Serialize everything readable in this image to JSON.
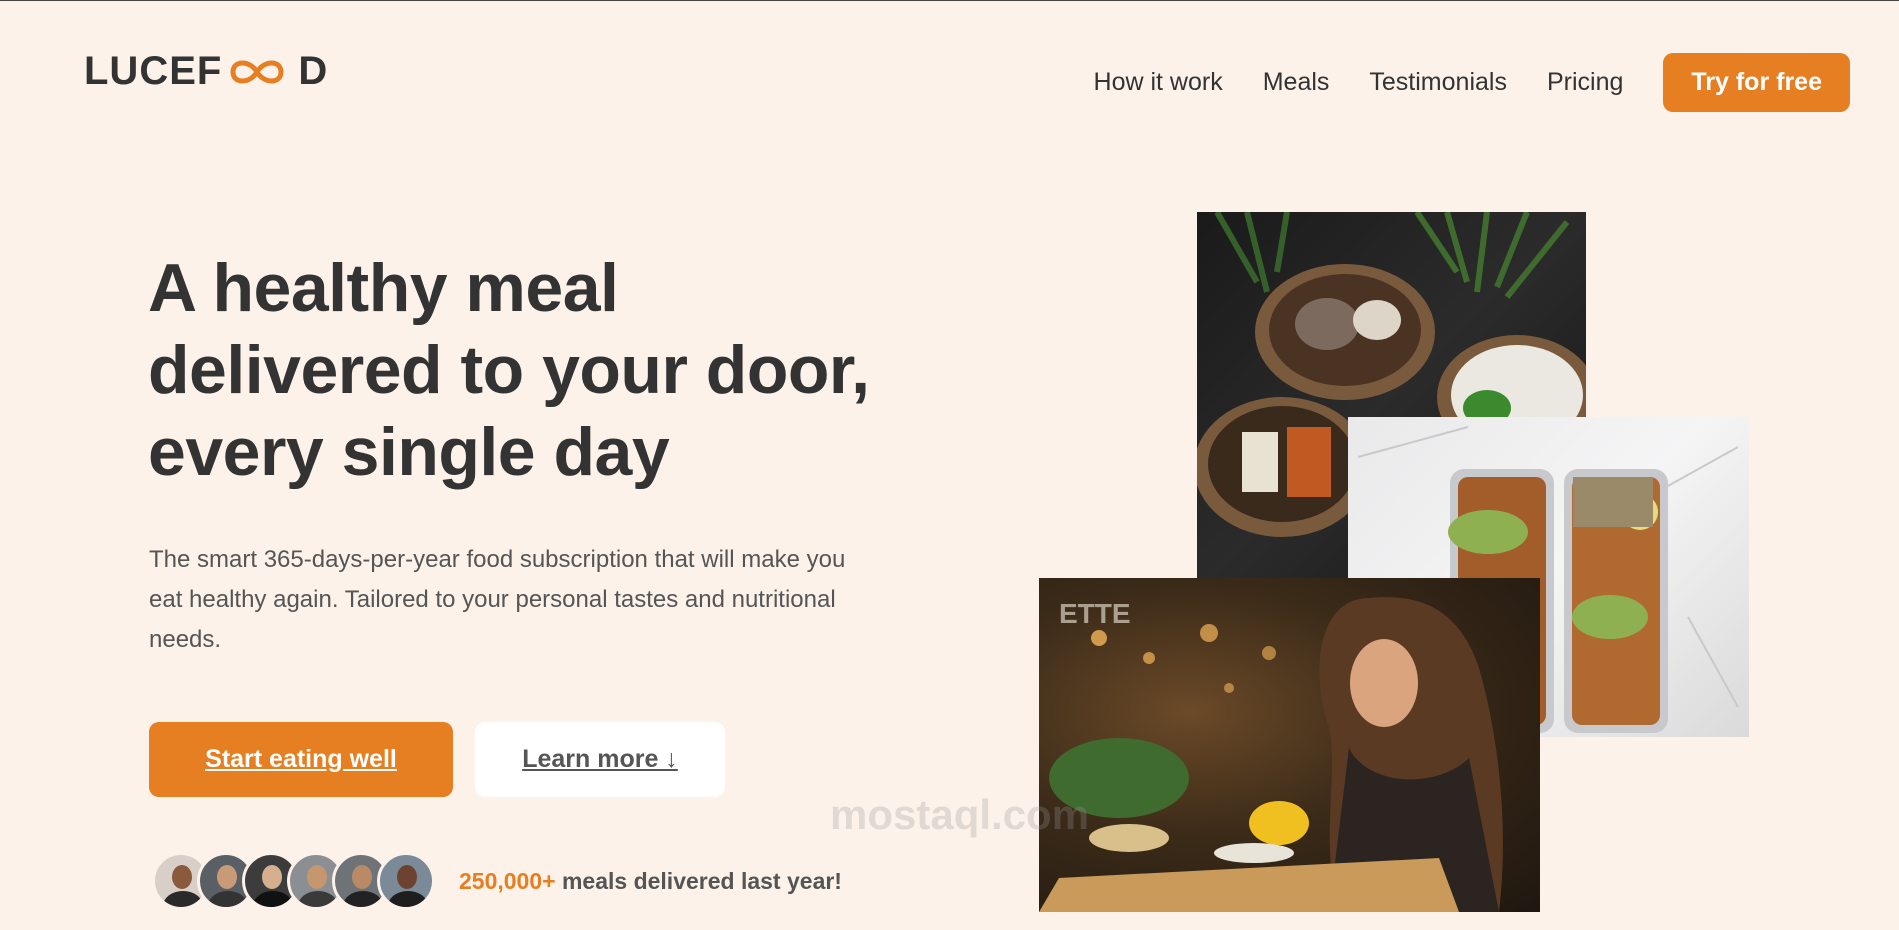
{
  "header": {
    "logo_left": "LUCEF",
    "logo_right": "D",
    "nav": [
      "How it work",
      "Meals",
      "Testimonials",
      "Pricing"
    ],
    "cta": "Try for free"
  },
  "hero": {
    "title": "A healthy meal delivered to your door, every single day",
    "description": "The smart 365-days-per-year food subscription that will make you eat healthy again. Tailored to your personal tastes and nutritional needs.",
    "primary_button": "Start eating well",
    "secondary_button": "Learn more ↓"
  },
  "delivered": {
    "count": "250,000+",
    "text": " meals delivered last year!"
  },
  "watermark": "mostaql.com",
  "colors": {
    "accent": "#e67e22",
    "background": "#fdf2e9",
    "text": "#333333"
  }
}
